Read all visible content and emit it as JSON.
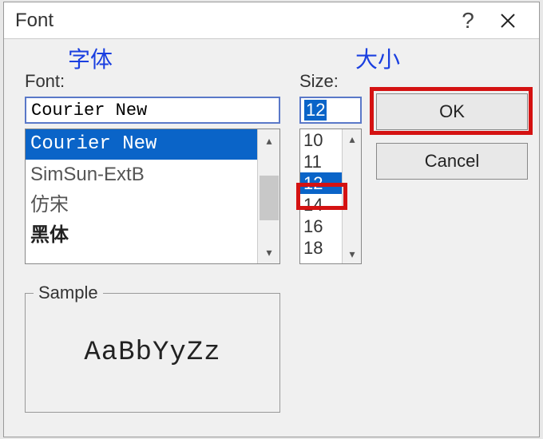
{
  "dialog": {
    "title": "Font"
  },
  "annotations": {
    "font_zh": "字体",
    "size_zh": "大小"
  },
  "font_section": {
    "label": "Font:",
    "value": "Courier New",
    "items": [
      {
        "name": "Courier New",
        "selected": true,
        "style": "mono"
      },
      {
        "name": "SimSun-ExtB",
        "selected": false,
        "style": "cjk"
      },
      {
        "name": "仿宋",
        "selected": false,
        "style": "cjk"
      },
      {
        "name": "黑体",
        "selected": false,
        "style": "heavy"
      }
    ]
  },
  "size_section": {
    "label": "Size:",
    "value": "12",
    "items": [
      {
        "v": "10",
        "selected": false
      },
      {
        "v": "11",
        "selected": false
      },
      {
        "v": "12",
        "selected": true
      },
      {
        "v": "14",
        "selected": false
      },
      {
        "v": "16",
        "selected": false
      },
      {
        "v": "18",
        "selected": false
      }
    ]
  },
  "buttons": {
    "ok": "OK",
    "cancel": "Cancel"
  },
  "sample": {
    "legend": "Sample",
    "text": "AaBbYyZz"
  }
}
